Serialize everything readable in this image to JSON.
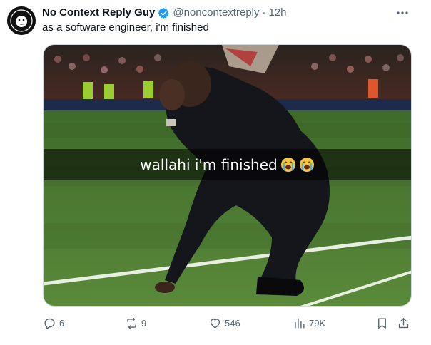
{
  "author": {
    "name": "No Context Reply Guy",
    "handle": "@noncontextreply",
    "separator": "·",
    "time": "12h",
    "verified_color": "#1d9bf0"
  },
  "tweet": {
    "text": "as a software engineer, i'm finished"
  },
  "media": {
    "caption": "wallahi i'm finished",
    "emojis": [
      "loudly-crying-face",
      "loudly-crying-face"
    ]
  },
  "actions": {
    "replies": "6",
    "reposts": "9",
    "likes": "546",
    "views": "79K"
  },
  "colors": {
    "text_primary": "#0f1419",
    "text_secondary": "#536471",
    "accent": "#1d9bf0"
  }
}
